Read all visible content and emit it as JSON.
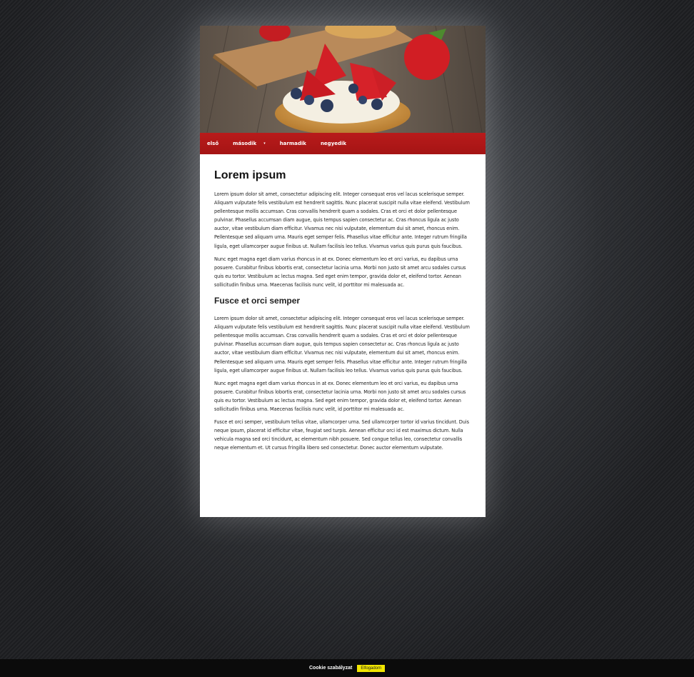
{
  "nav": {
    "items": [
      {
        "label": "első"
      },
      {
        "label": "második",
        "has_submenu": true,
        "submenu_icon": "caret-down-icon"
      },
      {
        "label": "harmadik"
      },
      {
        "label": "negyedik"
      }
    ],
    "background_color": "#a51414"
  },
  "article": {
    "title": "Lorem ipsum",
    "paragraphs_1": [
      "Lorem ipsum dolor sit amet, consectetur adipiscing elit. Integer consequat eros vel lacus scelerisque semper. Aliquam vulputate felis vestibulum est hendrerit sagittis. Nunc placerat suscipit nulla vitae eleifend. Vestibulum pellentesque mollis accumsan. Cras convallis hendrerit quam a sodales. Cras et orci et dolor pellentesque pulvinar. Phasellus accumsan diam augue, quis tempus sapien consectetur ac. Cras rhoncus ligula ac justo auctor, vitae vestibulum diam efficitur. Vivamus nec nisi vulputate, elementum dui sit amet, rhoncus enim. Pellentesque sed aliquam urna. Mauris eget semper felis. Phasellus vitae efficitur ante. Integer rutrum fringilla ligula, eget ullamcorper augue finibus ut. Nullam facilisis leo tellus. Vivamus varius quis purus quis faucibus.",
      "Nunc eget magna eget diam varius rhoncus in at ex. Donec elementum leo et orci varius, eu dapibus urna posuere. Curabitur finibus lobortis erat, consectetur lacinia urna. Morbi non justo sit amet arcu sodales cursus quis eu tortor. Vestibulum ac lectus magna. Sed eget enim tempor, gravida dolor et, eleifend tortor. Aenean sollicitudin finibus urna. Maecenas facilisis nunc velit, id porttitor mi malesuada ac."
    ],
    "subtitle": "Fusce et orci semper",
    "paragraphs_2": [
      "Lorem ipsum dolor sit amet, consectetur adipiscing elit. Integer consequat eros vel lacus scelerisque semper. Aliquam vulputate felis vestibulum est hendrerit sagittis. Nunc placerat suscipit nulla vitae eleifend. Vestibulum pellentesque mollis accumsan. Cras convallis hendrerit quam a sodales. Cras et orci et dolor pellentesque pulvinar. Phasellus accumsan diam augue, quis tempus sapien consectetur ac. Cras rhoncus ligula ac justo auctor, vitae vestibulum diam efficitur. Vivamus nec nisi vulputate, elementum dui sit amet, rhoncus enim. Pellentesque sed aliquam urna. Mauris eget semper felis. Phasellus vitae efficitur ante. Integer rutrum fringilla ligula, eget ullamcorper augue finibus ut. Nullam facilisis leo tellus. Vivamus varius quis purus quis faucibus.",
      "Nunc eget magna eget diam varius rhoncus in at ex. Donec elementum leo et orci varius, eu dapibus urna posuere. Curabitur finibus lobortis erat, consectetur lacinia urna. Morbi non justo sit amet arcu sodales cursus quis eu tortor. Vestibulum ac lectus magna. Sed eget enim tempor, gravida dolor et, eleifend tortor. Aenean sollicitudin finibus urna. Maecenas facilisis nunc velit, id porttitor mi malesuada ac.",
      "Fusce et orci semper, vestibulum tellus vitae, ullamcorper urna. Sed ullamcorper tortor id varius tincidunt. Duis neque ipsum, placerat id efficitur vitae, feugiat sed turpis. Aenean efficitur orci id est maximus dictum. Nulla vehicula magna sed orci tincidunt, ac elementum nibh posuere. Sed congue tellus leo, consectetur convallis neque elementum et. Ut cursus fringilla libero sed consectetur. Donec auctor elementum vulputate."
    ]
  },
  "cookie_bar": {
    "text": "Cookie szabályzat",
    "accept_label": "Elfogadom",
    "accept_color": "#f2e600"
  }
}
